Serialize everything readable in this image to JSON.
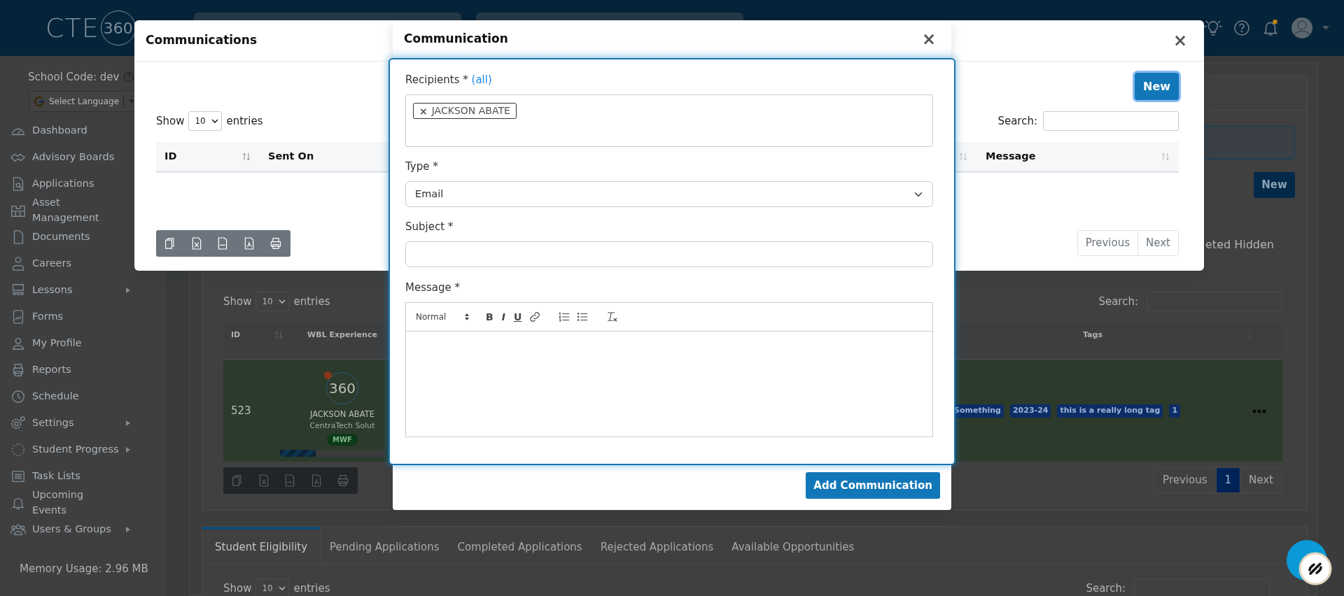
{
  "header": {
    "logo_text": "CTE",
    "logo_mark": "360"
  },
  "sidebar": {
    "school_code": "School Code: dev",
    "language": "Select Language",
    "items": [
      {
        "label": "Dashboard",
        "expandable": false
      },
      {
        "label": "Advisory Boards",
        "expandable": false
      },
      {
        "label": "Applications",
        "expandable": false
      },
      {
        "label": "Asset Management",
        "expandable": false
      },
      {
        "label": "Documents",
        "expandable": false
      },
      {
        "label": "Careers",
        "expandable": false
      },
      {
        "label": "Lessons",
        "expandable": true
      },
      {
        "label": "Forms",
        "expandable": false
      },
      {
        "label": "My Profile",
        "expandable": false
      },
      {
        "label": "Reports",
        "expandable": false
      },
      {
        "label": "Schedule",
        "expandable": false
      },
      {
        "label": "Settings",
        "expandable": true
      },
      {
        "label": "Student Progress",
        "expandable": true
      },
      {
        "label": "Task Lists",
        "expandable": false
      },
      {
        "label": "Upcoming Events",
        "expandable": false
      },
      {
        "label": "Users & Groups",
        "expandable": true
      }
    ],
    "memory": "Memory Usage: 2.96 MB"
  },
  "page": {
    "filter_label": "eted Hidden",
    "new_button": "New",
    "wbl_table": {
      "show": "Show",
      "length": "10",
      "entries": "entries",
      "search_label": "Search:",
      "columns": [
        {
          "label": "ID"
        },
        {
          "label": "WBL Experience"
        },
        {
          "label": "Tags"
        }
      ],
      "rows": [
        {
          "id": "523",
          "logo": "360",
          "student": "JACKSON ABATE",
          "company": "CentraTech Solut",
          "schedule": "MWF",
          "level": 0.34,
          "tags": [
            {
              "label": "Something"
            },
            {
              "label": "2023-24"
            },
            {
              "label": "this is a really long tag"
            },
            {
              "label": "1"
            }
          ]
        }
      ],
      "pagination": [
        {
          "label": "Previous",
          "selected": false
        },
        {
          "label": "1",
          "selected": true
        },
        {
          "label": "Next",
          "selected": false
        }
      ]
    },
    "tabs": [
      {
        "label": "Student Eligibility",
        "selected": true
      },
      {
        "label": "Pending Applications",
        "selected": false
      },
      {
        "label": "Completed Applications",
        "selected": false
      },
      {
        "label": "Rejected Applications",
        "selected": false
      },
      {
        "label": "Available Opportunities",
        "selected": false
      }
    ],
    "tab_table": {
      "show": "Show",
      "length": "10",
      "entries": "entries",
      "search_label": "Search:"
    }
  },
  "communications_modal": {
    "title": "Communications",
    "close": "×",
    "new_button": {
      "label": "New",
      "focused": true
    },
    "show": "Show",
    "length": "10",
    "entries": "entries",
    "search_label": "Search:",
    "columns": [
      {
        "label": "ID"
      },
      {
        "label": "Sent On"
      },
      {
        "label": "Message"
      }
    ],
    "pagination": [
      {
        "label": "Previous"
      },
      {
        "label": "Next"
      }
    ]
  },
  "communication_modal": {
    "title": "Communication",
    "close": "×",
    "recipients_label": "Recipients *",
    "all_link": "(all)",
    "recipients": [
      {
        "remove": "×",
        "name": "JACKSON ABATE"
      }
    ],
    "type_label": "Type *",
    "type_value": "Email",
    "subject_label": "Subject *",
    "message_label": "Message *",
    "editor_format": "Normal",
    "editor_buttons": [
      "B",
      "I",
      "U"
    ],
    "submit": "Add Communication"
  }
}
